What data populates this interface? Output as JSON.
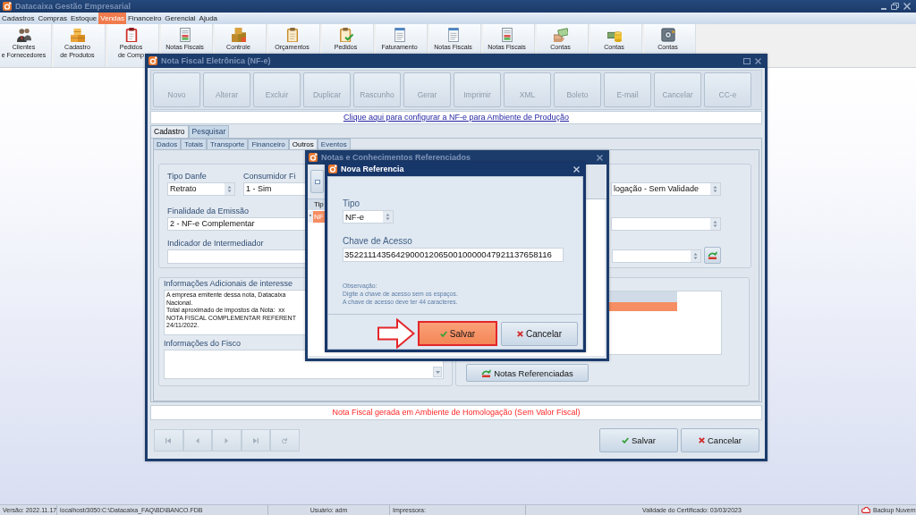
{
  "app": {
    "title": "Datacaixa Gestão Empresarial"
  },
  "menu": [
    {
      "label": "Cadastros",
      "selected": false
    },
    {
      "label": "Compras",
      "selected": false
    },
    {
      "label": "Estoque",
      "selected": false
    },
    {
      "label": "Vendas",
      "selected": true
    },
    {
      "label": "Financeiro",
      "selected": false
    },
    {
      "label": "Gerencial",
      "selected": false
    },
    {
      "label": "Ajuda",
      "selected": false
    }
  ],
  "toolbar": [
    {
      "label": "Clientes\ne Fornecedores"
    },
    {
      "label": "Cadastro\nde Produtos"
    },
    {
      "label": "Pedidos\nde Comp"
    },
    {
      "label": "Notas Fiscais"
    },
    {
      "label": "Controle"
    },
    {
      "label": "Orçamentos"
    },
    {
      "label": "Pedidos"
    },
    {
      "label": "Faturamento"
    },
    {
      "label": "Notas Fiscais"
    },
    {
      "label": "Notas Fiscais"
    },
    {
      "label": "Contas"
    },
    {
      "label": "Contas"
    },
    {
      "label": "Contas"
    }
  ],
  "nfe_window": {
    "title": "Nota Fiscal Eletrônica (NF-e)",
    "toolbar": [
      {
        "label": "Novo",
        "disabled": true
      },
      {
        "label": "Alterar",
        "disabled": true
      },
      {
        "label": "Excluir",
        "disabled": true
      },
      {
        "label": "Duplicar",
        "disabled": true
      },
      {
        "label": "Rascunho",
        "disabled": true
      },
      {
        "label": "Gerar",
        "disabled": true
      },
      {
        "label": "Imprimir",
        "disabled": true
      },
      {
        "label": "XML",
        "disabled": true
      },
      {
        "label": "Boleto",
        "disabled": true
      },
      {
        "label": "E-mail",
        "disabled": true
      },
      {
        "label": "Cancelar",
        "disabled": true
      },
      {
        "label": "CC-e",
        "disabled": true
      }
    ],
    "config_link": "Clique aqui para configurar a NF-e para Ambiente de Produção",
    "tabs": [
      {
        "label": "Cadastro",
        "selected": true
      },
      {
        "label": "Pesquisar",
        "selected": false
      }
    ],
    "subtabs": [
      {
        "label": "Dados",
        "selected": false
      },
      {
        "label": "Totais",
        "selected": false
      },
      {
        "label": "Transporte",
        "selected": false
      },
      {
        "label": "Financeiro",
        "selected": false
      },
      {
        "label": "Outros",
        "selected": true
      },
      {
        "label": "Eventos",
        "selected": false
      }
    ],
    "tipo_danfe": {
      "label": "Tipo Danfe",
      "value": "Retrato"
    },
    "consumidor_final": {
      "label": "Consumidor Fi",
      "value": "1 - Sim"
    },
    "ambiente": {
      "value": "logação - Sem Validade"
    },
    "finalidade": {
      "label": "Finalidade da Emissão",
      "value": "2 - NF-e Complementar"
    },
    "intermediador": {
      "label": "Indicador de Intermediador"
    },
    "info_adicionais": {
      "label": "Informações Adicionais de interesse",
      "text": "A empresa emitente dessa nota, Datacaixa\nNacional.\nTotal aproximado de impostos da Nota:  xx\nNOTA FISCAL COMPLEMENTAR REFERENT\n24/11/2022."
    },
    "info_fisco": {
      "label": "Informações do Fisco"
    },
    "referenced_grid": {
      "rows": [
        {
          "selected": true
        }
      ]
    },
    "notas_button": "Notas Referenciadas",
    "notice": "Nota Fiscal gerada em Ambiente de Homologação (Sem Valor Fiscal)",
    "buttons": [
      {
        "label": "Salvar",
        "kind": "save"
      },
      {
        "label": "Cancelar",
        "kind": "cancel"
      }
    ]
  },
  "notas_window": {
    "title": "Notas e Conhecimentos Referenciados",
    "grid": {
      "columns": [
        "Tip"
      ],
      "rows": [
        {
          "indicator": "*",
          "cells": [
            "NF"
          ],
          "selected": true
        }
      ]
    }
  },
  "dialog": {
    "title": "Nova Referencia",
    "tipo": {
      "label": "Tipo",
      "value": "NF-e"
    },
    "chave": {
      "label": "Chave de Acesso",
      "value": "35221114356429000120650010000047921137658116"
    },
    "note": "Observação:\nDigite a chave de acesso sem os espaços.\nA chave de acesso deve ter 44 caracteres.",
    "buttons": [
      {
        "label": "Salvar",
        "kind": "save",
        "highlighted": true,
        "callout": true
      },
      {
        "label": "Cancelar",
        "kind": "cancel",
        "highlighted": false,
        "callout": false
      }
    ]
  },
  "status_bar": {
    "panels": [
      "Versão: 2022.11.17",
      "localhost/3050:C:\\Datacaixa_FAQ\\BD\\BANCO.FDB",
      "Usuário: adm",
      "Impressora:",
      "Validade do Certificado: 03/03/2023"
    ],
    "backup": "Backup Nuvem"
  }
}
